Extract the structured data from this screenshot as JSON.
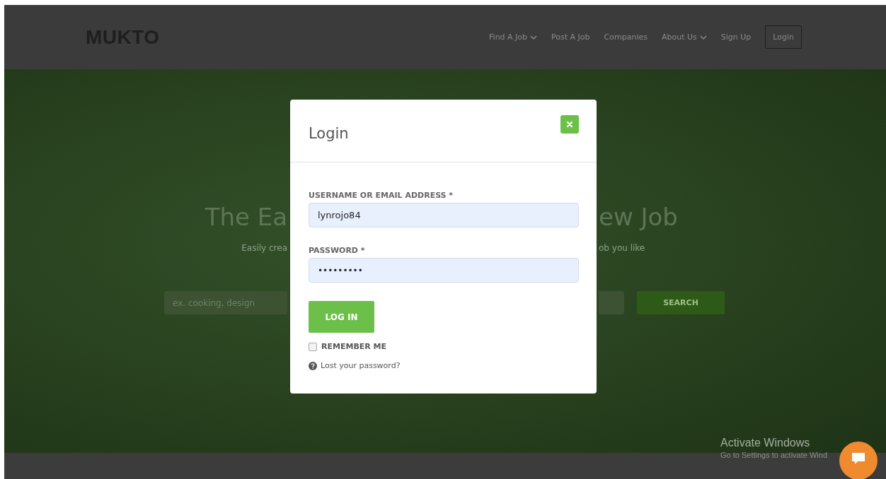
{
  "header": {
    "logo": "MUKTO",
    "nav": [
      {
        "label": "Find A Job",
        "dropdown": true
      },
      {
        "label": "Post A Job",
        "dropdown": false
      },
      {
        "label": "Companies",
        "dropdown": false
      },
      {
        "label": "About Us",
        "dropdown": true
      },
      {
        "label": "Sign Up",
        "dropdown": false
      }
    ],
    "login_button": "Login"
  },
  "hero": {
    "title_left": "The Ea",
    "title_right": "ew Job",
    "subtitle_left": "Easily crea",
    "subtitle_right": "ob you like",
    "search_placeholder": "ex. cooking, design",
    "search_button": "SEARCH"
  },
  "modal": {
    "title": "Login",
    "username_label": "USERNAME OR EMAIL ADDRESS *",
    "username_value": "lynrojo84",
    "password_label": "PASSWORD *",
    "password_value": "•••••••••",
    "login_button": "LOG IN",
    "remember": {
      "label": "REMEMBER ME",
      "checked": false
    },
    "lost_password": "Lost your password?"
  },
  "os_notice": {
    "title": "Activate Windows",
    "text": "Go to Settings to activate Wind"
  }
}
